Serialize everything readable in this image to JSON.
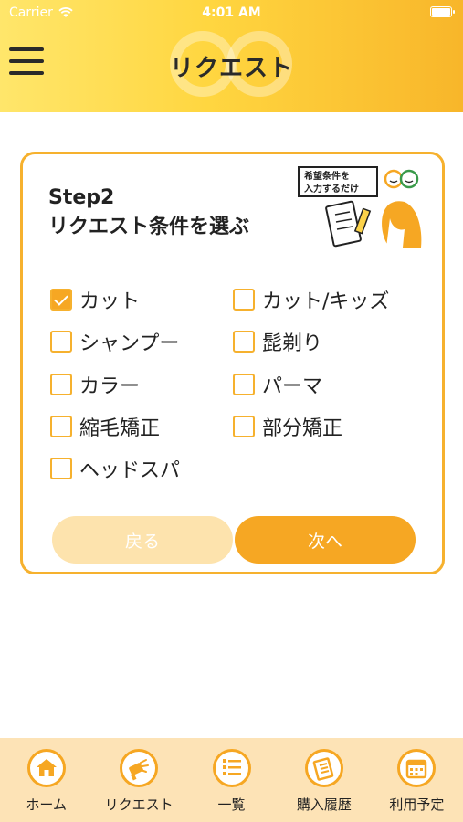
{
  "status": {
    "carrier": "Carrier",
    "time": "4:01 AM"
  },
  "header": {
    "title": "リクエスト"
  },
  "card": {
    "step": "Step2",
    "subtitle": "リクエスト条件を選ぶ",
    "illust_text_1": "希望条件を",
    "illust_text_2": "入力するだけ",
    "options": [
      {
        "label": "カット",
        "checked": true
      },
      {
        "label": "カット/キッズ",
        "checked": false
      },
      {
        "label": "シャンプー",
        "checked": false
      },
      {
        "label": "髭剃り",
        "checked": false
      },
      {
        "label": "カラー",
        "checked": false
      },
      {
        "label": "パーマ",
        "checked": false
      },
      {
        "label": "縮毛矯正",
        "checked": false
      },
      {
        "label": "部分矯正",
        "checked": false
      },
      {
        "label": "ヘッドスパ",
        "checked": false
      }
    ],
    "back_label": "戻る",
    "next_label": "次へ"
  },
  "tabbar": {
    "tabs": [
      {
        "label": "ホーム",
        "icon": "home-icon"
      },
      {
        "label": "リクエスト",
        "icon": "request-icon"
      },
      {
        "label": "一覧",
        "icon": "list-icon"
      },
      {
        "label": "購入履歴",
        "icon": "purchase-history-icon"
      },
      {
        "label": "利用予定",
        "icon": "calendar-icon"
      }
    ]
  },
  "colors": {
    "accent": "#f6a723",
    "border": "#f6b12e",
    "disabled": "#fde3ad",
    "tabbar": "#fde3b6"
  }
}
